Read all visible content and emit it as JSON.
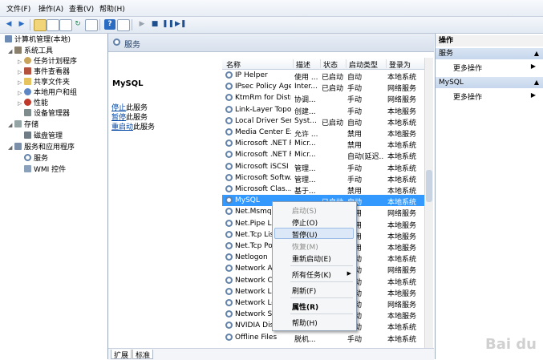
{
  "menubar": {
    "items": [
      "文件(F)",
      "操作(A)",
      "查看(V)",
      "帮助(H)"
    ]
  },
  "tree": {
    "root": "计算机管理(本地)",
    "system_tools": "系统工具",
    "task_scheduler": "任务计划程序",
    "event_viewer": "事件查看器",
    "shared_folders": "共享文件夹",
    "local_users": "本地用户和组",
    "performance": "性能",
    "device_manager": "设备管理器",
    "storage": "存储",
    "disk_mgmt": "磁盘管理",
    "services_apps": "服务和应用程序",
    "services": "服务",
    "wmi": "WMI 控件"
  },
  "center": {
    "header_title": "服务",
    "selected_service": "MySQL",
    "actions": [
      {
        "link": "停止",
        "rest": "此服务"
      },
      {
        "link": "暂停",
        "rest": "此服务"
      },
      {
        "link": "重启动",
        "rest": "此服务"
      }
    ],
    "columns": [
      "名称",
      "描述",
      "状态",
      "启动类型",
      "登录为"
    ],
    "rows": [
      {
        "name": "IP Helper",
        "desc": "使用 ...",
        "status": "已启动",
        "startup": "自动",
        "logon": "本地系统"
      },
      {
        "name": "IPsec Policy Agent",
        "desc": "Inter...",
        "status": "已启动",
        "startup": "手动",
        "logon": "网络服务"
      },
      {
        "name": "KtmRm for Distri...",
        "desc": "协调...",
        "status": "",
        "startup": "手动",
        "logon": "网络服务"
      },
      {
        "name": "Link-Layer Topol...",
        "desc": "创建...",
        "status": "",
        "startup": "手动",
        "logon": "本地服务"
      },
      {
        "name": "Local Driver Ser...",
        "desc": "Syst...",
        "status": "已启动",
        "startup": "自动",
        "logon": "本地系统"
      },
      {
        "name": "Media Center Ex...",
        "desc": "允许 ...",
        "status": "",
        "startup": "禁用",
        "logon": "本地服务"
      },
      {
        "name": "Microsoft .NET F...",
        "desc": "Micr...",
        "status": "",
        "startup": "禁用",
        "logon": "本地系统"
      },
      {
        "name": "Microsoft .NET F...",
        "desc": "Micr...",
        "status": "",
        "startup": "自动(延迟...",
        "logon": "本地系统"
      },
      {
        "name": "Microsoft iSCSI I...",
        "desc": "管理...",
        "status": "",
        "startup": "手动",
        "logon": "本地系统"
      },
      {
        "name": "Microsoft Softw...",
        "desc": "管理...",
        "status": "",
        "startup": "手动",
        "logon": "本地系统"
      },
      {
        "name": "Microsoft Clas...",
        "desc": "基于...",
        "status": "",
        "startup": "禁用",
        "logon": "本地系统"
      },
      {
        "name": "MySQL",
        "desc": "",
        "status": "已启动",
        "startup": "自动",
        "logon": "本地系统"
      },
      {
        "name": "Net.Msmq L...",
        "desc": "",
        "status": "",
        "startup": "禁用",
        "logon": "网络服务"
      },
      {
        "name": "Net.Pipe Lis...",
        "desc": "",
        "status": "",
        "startup": "禁用",
        "logon": "本地服务"
      },
      {
        "name": "Net.Tcp List...",
        "desc": "",
        "status": "",
        "startup": "禁用",
        "logon": "本地服务"
      },
      {
        "name": "Net.Tcp Por...",
        "desc": "",
        "status": "",
        "startup": "禁用",
        "logon": "本地服务"
      },
      {
        "name": "Netlogon",
        "desc": "",
        "status": "",
        "startup": "手动",
        "logon": "本地系统"
      },
      {
        "name": "Network Ac...",
        "desc": "",
        "status": "",
        "startup": "手动",
        "logon": "网络服务"
      },
      {
        "name": "Network Co...",
        "desc": "",
        "status": "",
        "startup": "手动",
        "logon": "本地系统"
      },
      {
        "name": "Network Lis...",
        "desc": "",
        "status": "",
        "startup": "手动",
        "logon": "本地服务"
      },
      {
        "name": "Network Lo...",
        "desc": "",
        "status": "",
        "startup": "自动",
        "logon": "网络服务"
      },
      {
        "name": "Network Sto...",
        "desc": "",
        "status": "",
        "startup": "手动",
        "logon": "本地服务"
      },
      {
        "name": "NVIDIA Disp...",
        "desc": "",
        "status": "",
        "startup": "自动",
        "logon": "本地系统"
      },
      {
        "name": "Offline Files",
        "desc": "脱机...",
        "status": "",
        "startup": "手动",
        "logon": "本地系统"
      }
    ],
    "bottom_tabs": [
      "扩展",
      "标准"
    ]
  },
  "right": {
    "header": "操作",
    "section1": "服务",
    "section1_item": "更多操作",
    "section2": "MySQL",
    "section2_item": "更多操作"
  },
  "context_menu": {
    "start": "启动(S)",
    "stop": "停止(O)",
    "pause": "暂停(U)",
    "resume": "恢复(M)",
    "restart": "重新启动(E)",
    "all_tasks": "所有任务(K)",
    "refresh": "刷新(F)",
    "properties": "属性(R)",
    "help": "帮助(H)"
  },
  "colors": {
    "selection": "#3399ff",
    "link": "#0046a5",
    "section_header": "#c6d6ec"
  }
}
